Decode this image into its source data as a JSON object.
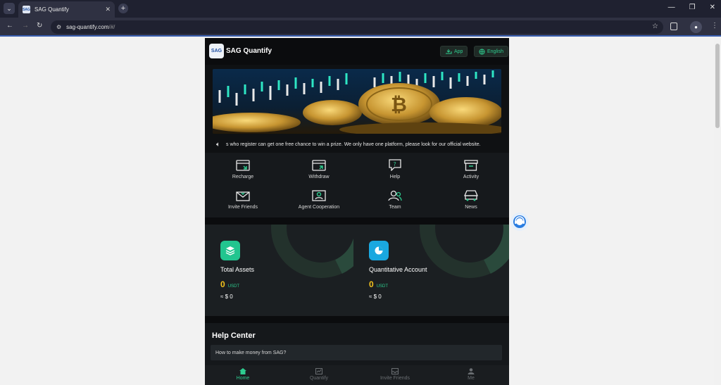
{
  "browser": {
    "tab_title": "SAG Quantify",
    "url_host": "sag-quantify.com",
    "url_path": "/#/",
    "favicon_text": "SAG"
  },
  "header": {
    "logo_text": "SAG",
    "app_name": "SAG Quantify",
    "app_button": "App",
    "language_button": "English"
  },
  "ticker": {
    "text": "s who register can get one free chance to win a prize. We only have one platform, please look for our official website."
  },
  "menu": [
    {
      "label": "Recharge",
      "icon": "recharge-icon"
    },
    {
      "label": "Withdraw",
      "icon": "withdraw-icon"
    },
    {
      "label": "Help",
      "icon": "help-icon"
    },
    {
      "label": "Activity",
      "icon": "activity-icon"
    },
    {
      "label": "Invite Friends",
      "icon": "invite-icon"
    },
    {
      "label": "Agent Cooperation",
      "icon": "agent-icon"
    },
    {
      "label": "Team",
      "icon": "team-icon"
    },
    {
      "label": "News",
      "icon": "news-icon"
    }
  ],
  "cards": [
    {
      "title": "Total Assets",
      "value": "0",
      "unit": "USDT",
      "usd": "≈ $ 0",
      "icon": "layers-icon",
      "icon_color": "#22c58f"
    },
    {
      "title": "Quantitative Account",
      "value": "0",
      "unit": "USDT",
      "usd": "≈ $ 0",
      "icon": "pie-chart-icon",
      "icon_color": "#1aa8e0"
    }
  ],
  "help": {
    "title": "Help Center",
    "items": [
      "How to make money from SAG?"
    ]
  },
  "bottom_nav": [
    {
      "label": "Home",
      "icon": "home-icon",
      "active": true
    },
    {
      "label": "Quantify",
      "icon": "quantify-icon",
      "active": false
    },
    {
      "label": "Invite Friends",
      "icon": "invite-tray-icon",
      "active": false
    },
    {
      "label": "Me",
      "icon": "person-icon",
      "active": false
    }
  ],
  "colors": {
    "accent": "#2ecc8f",
    "value": "#f3c21c"
  }
}
